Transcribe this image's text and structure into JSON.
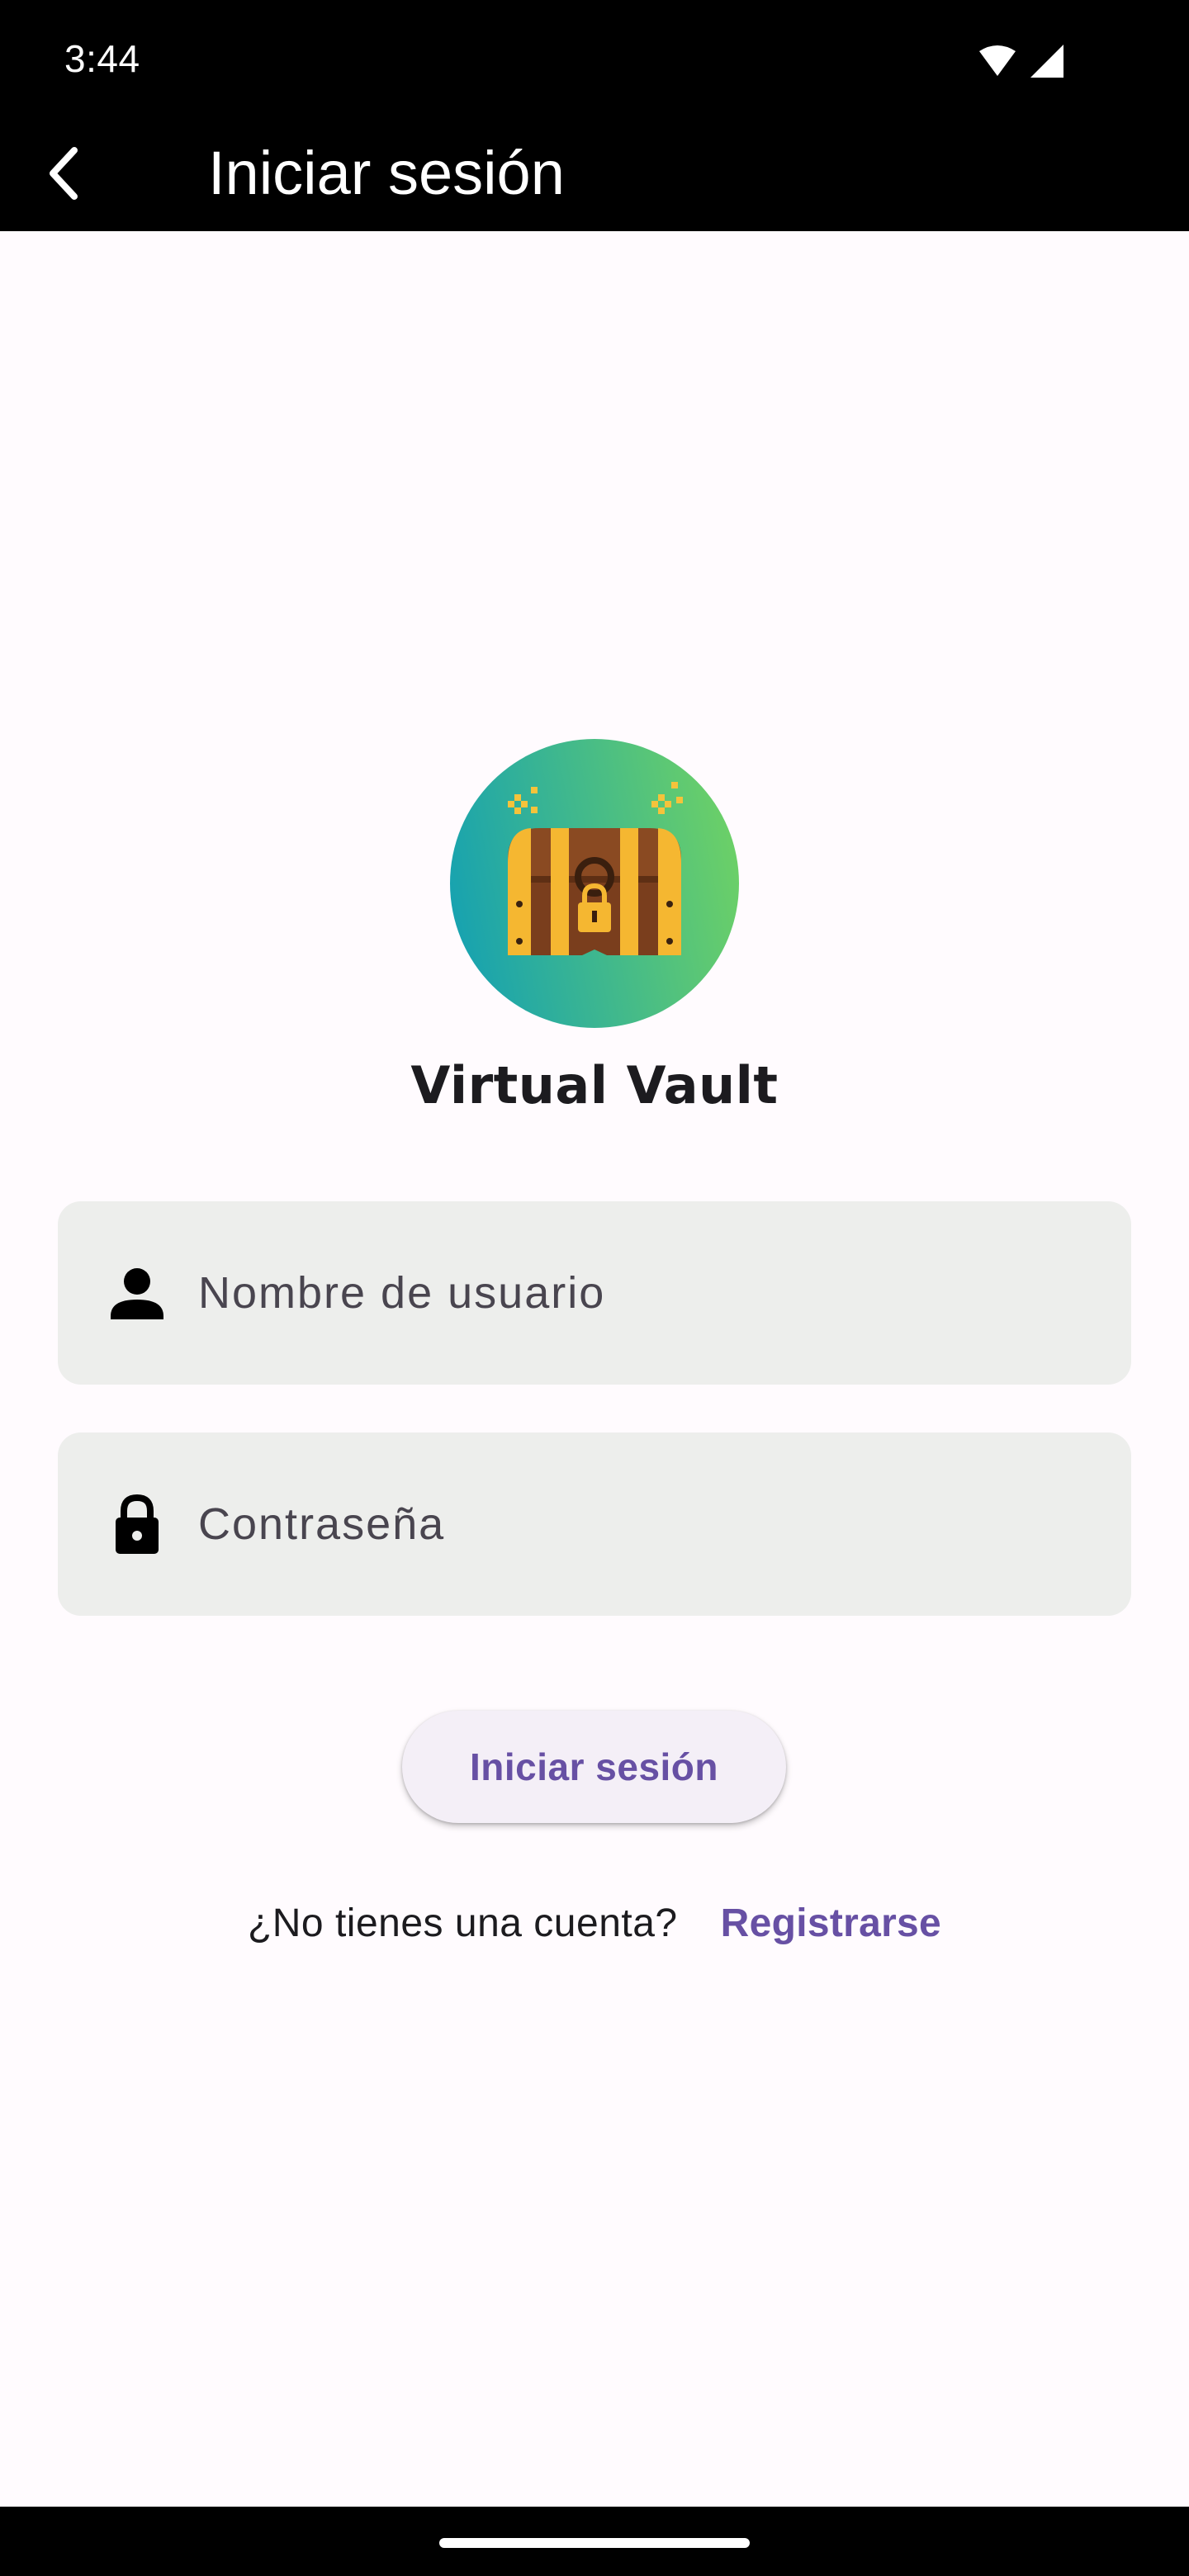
{
  "status_bar": {
    "time": "3:44",
    "icons": [
      "wifi-icon",
      "cellular-signal-icon"
    ]
  },
  "app_bar": {
    "title": "Iniciar sesión",
    "back_icon": "chevron-left-icon"
  },
  "brand": {
    "logo_icon": "treasure-chest-icon",
    "name": "Virtual Vault"
  },
  "form": {
    "username": {
      "icon": "person-icon",
      "value": "",
      "placeholder": "Nombre de usuario"
    },
    "password": {
      "icon": "lock-icon",
      "value": "",
      "placeholder": "Contraseña"
    },
    "submit_label": "Iniciar sesión"
  },
  "signup": {
    "question": "¿No tienes una cuenta?",
    "link_label": "Registrarse"
  },
  "colors": {
    "primary": "#6750A4",
    "background": "#FFFBFE",
    "field_background": "#EDEEEC",
    "logo_gradient_start": "#17A2B0",
    "logo_gradient_end": "#6CD067"
  }
}
